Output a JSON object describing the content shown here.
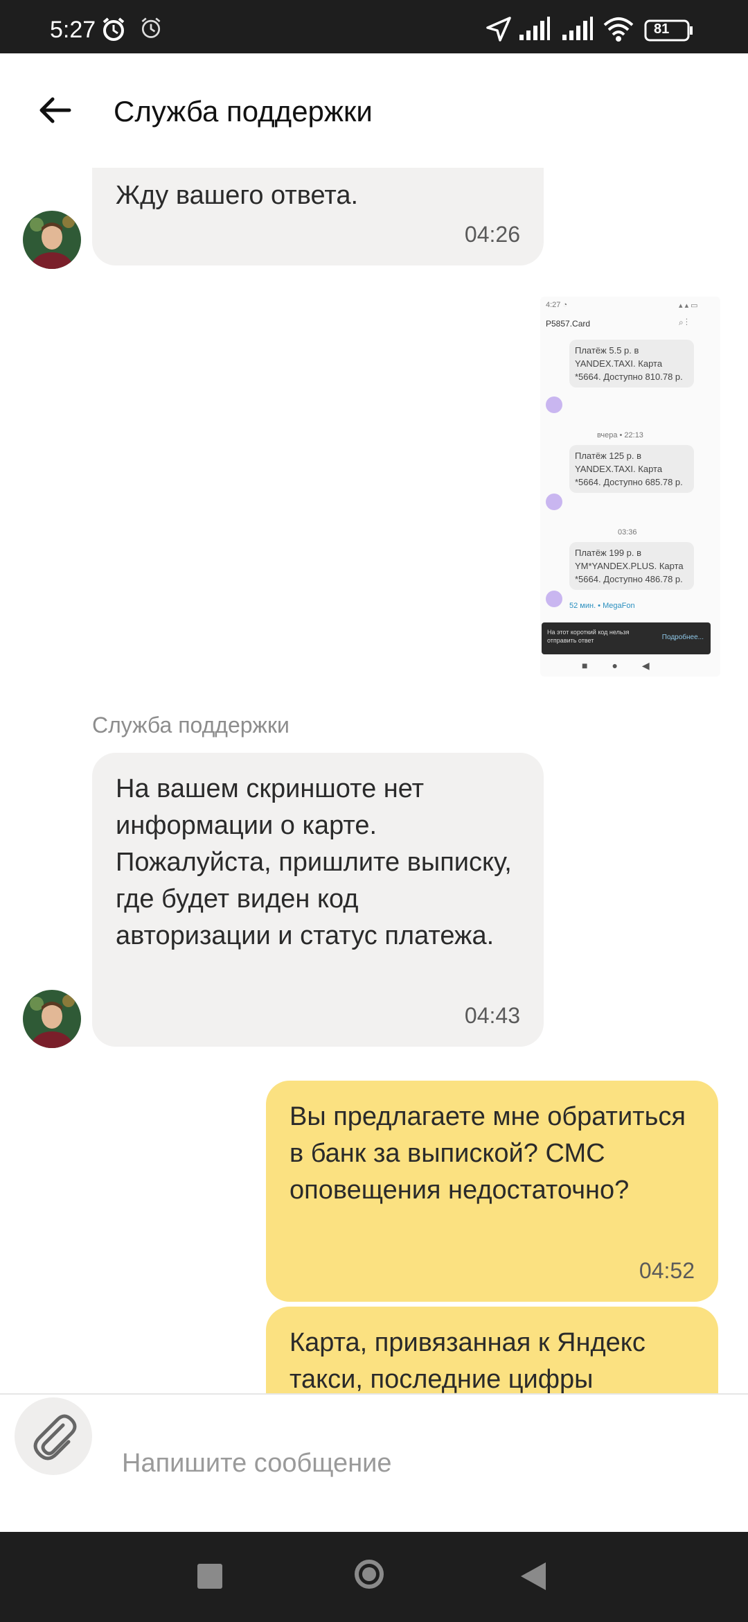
{
  "status_bar": {
    "time": "5:27",
    "battery": "81",
    "icons": [
      "alarm-icon",
      "alarm-icon",
      "location-icon",
      "signal-icon",
      "signal-icon",
      "wifi-icon",
      "battery-icon"
    ]
  },
  "header": {
    "title": "Служба поддержки",
    "back_icon": "arrow-left-icon"
  },
  "messages": [
    {
      "direction": "in",
      "text": "Жду вашего ответа.",
      "time": "04:26"
    },
    {
      "direction": "out",
      "type": "image",
      "image": {
        "header": "P5857.Card",
        "sms": [
          {
            "text": "Платёж 5.5 р. в YANDEX.TAXI. Карта *5664. Доступно 810.78 р."
          },
          {
            "text": "Платёж 125 р. в YANDEX.TAXI. Карта *5664. Доступно 685.78 р."
          },
          {
            "text": "Платёж 199 р. в YM*YANDEX.PLUS. Карта *5664. Доступно 486.78 р."
          }
        ],
        "separators": [
          "вчера • 22:13",
          "03:36"
        ],
        "footer_meta": "52 мин. • MegaFon",
        "banner_text": "На этот короткий код нельзя отправить ответ",
        "banner_action": "Подробнее..."
      }
    },
    {
      "direction": "in",
      "sender": "Служба поддержки",
      "text": "На вашем скриншоте нет информации о карте. Пожалуйста, пришлите выписку, где будет виден код авторизации и статус платежа.",
      "time": "04:43"
    },
    {
      "direction": "out",
      "text": "Вы предлагаете мне обратиться в банк за выпиской? СМС оповещения недостаточно?",
      "time": "04:52"
    },
    {
      "direction": "out",
      "text": "Карта, привязанная к Яндекс такси, последние цифры",
      "time": ""
    }
  ],
  "composer": {
    "placeholder": "Напишите сообщение",
    "attach_icon": "paperclip-icon"
  },
  "nav_bar": {
    "icons": [
      "recents-square-icon",
      "home-circle-icon",
      "back-triangle-icon"
    ]
  }
}
